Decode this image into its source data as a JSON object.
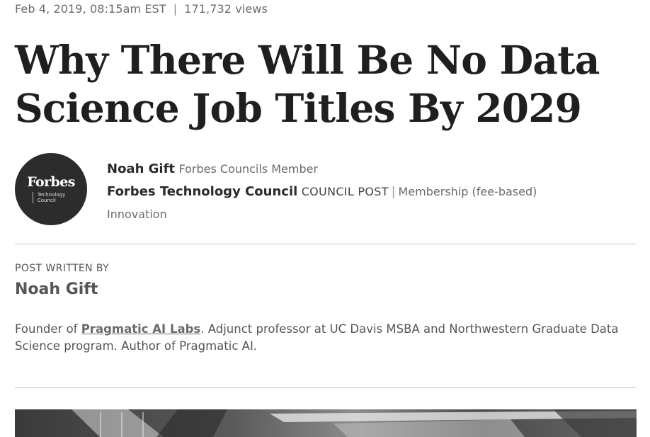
{
  "meta": {
    "date": "Feb 4, 2019, 08:15am EST",
    "separator": "|",
    "views": "171,732 views"
  },
  "article": {
    "title": "Why There Will Be No Data Science Job Titles By 2029"
  },
  "avatar": {
    "brand": "Forbes",
    "sub_line1": "Technology",
    "sub_line2": "Council"
  },
  "byline": {
    "author": "Noah Gift",
    "author_role": "Forbes Councils Member",
    "council": "Forbes Technology Council",
    "post_type": "COUNCIL POST",
    "separator": "|",
    "membership": "Membership (fee-based)",
    "category": "Innovation"
  },
  "author_box": {
    "label": "POST WRITTEN BY",
    "name": "Noah Gift",
    "bio_prefix": "Founder of ",
    "bio_org": "Pragmatic AI Labs",
    "bio_rest": ". Adjunct professor at UC Davis MSBA and Northwestern Graduate Data Science program. Author of Pragmatic AI."
  },
  "hero": {
    "icon": "hero-photo"
  }
}
